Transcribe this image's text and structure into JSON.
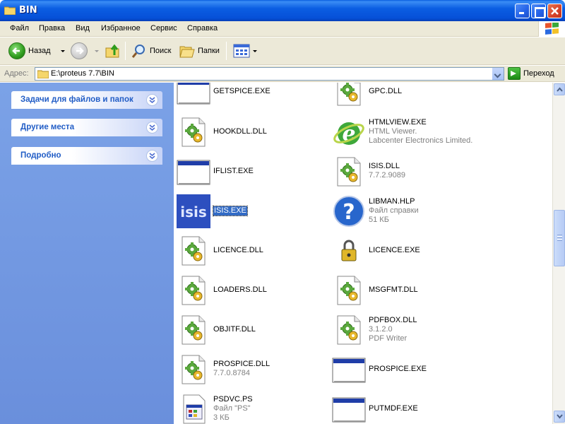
{
  "window": {
    "title": "BIN"
  },
  "menu": [
    "Файл",
    "Правка",
    "Вид",
    "Избранное",
    "Сервис",
    "Справка"
  ],
  "toolbar": {
    "back_label": "Назад",
    "search_label": "Поиск",
    "folders_label": "Папки"
  },
  "address": {
    "label": "Адрес:",
    "value": "E:\\proteus 7.7\\BIN",
    "go_label": "Переход"
  },
  "sidebar": {
    "groups": [
      {
        "title": "Задачи для файлов и папок"
      },
      {
        "title": "Другие места"
      },
      {
        "title": "Подробно"
      }
    ]
  },
  "files": [
    {
      "name": "GETSPICE.EXE",
      "icon": "window-exe-icon"
    },
    {
      "name": "GPC.DLL",
      "icon": "dll-icon"
    },
    {
      "name": "HOOKDLL.DLL",
      "icon": "dll-icon"
    },
    {
      "name": "HTMLVIEW.EXE",
      "line2": "HTML Viewer.",
      "line3": "Labcenter Electronics Limited.",
      "icon": "ie-icon"
    },
    {
      "name": "IFLIST.EXE",
      "icon": "window-exe-icon"
    },
    {
      "name": "ISIS.DLL",
      "line2": "7.7.2.9089",
      "icon": "dll-icon"
    },
    {
      "name": "ISIS.EXE",
      "icon": "isis-icon",
      "selected": true
    },
    {
      "name": "LIBMAN.HLP",
      "line2": "Файл справки",
      "line3": "51 КБ",
      "icon": "help-icon"
    },
    {
      "name": "LICENCE.DLL",
      "icon": "dll-icon"
    },
    {
      "name": "LICENCE.EXE",
      "icon": "lock-icon"
    },
    {
      "name": "LOADERS.DLL",
      "icon": "dll-icon"
    },
    {
      "name": "MSGFMT.DLL",
      "icon": "dll-icon"
    },
    {
      "name": "OBJITF.DLL",
      "icon": "dll-icon"
    },
    {
      "name": "PDFBOX.DLL",
      "line2": "3.1.2.0",
      "line3": "PDF Writer",
      "icon": "dll-icon"
    },
    {
      "name": "PROSPICE.DLL",
      "line2": "7.7.0.8784",
      "icon": "dll-icon"
    },
    {
      "name": "PROSPICE.EXE",
      "icon": "window-exe-icon"
    },
    {
      "name": "PSDVC.PS",
      "line2": "Файл \"PS\"",
      "line3": "3 КБ",
      "icon": "ps-file-icon"
    },
    {
      "name": "PUTMDF.EXE",
      "icon": "window-exe-icon"
    }
  ]
}
